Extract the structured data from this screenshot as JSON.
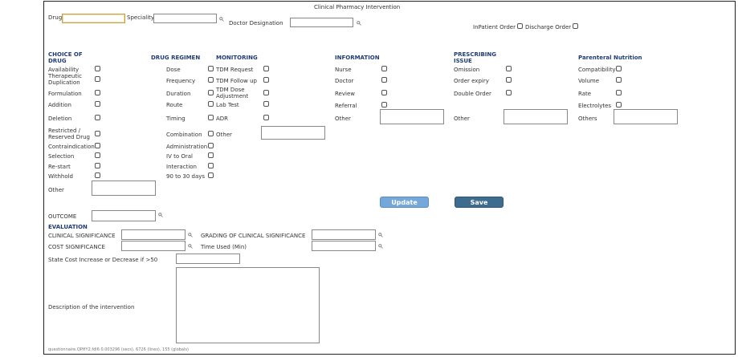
{
  "title": "Clinical Pharmacy Intervention",
  "top": {
    "drug_label": "Drug",
    "speciality_label": "Speciality",
    "doctor_designation_label": "Doctor Designation",
    "inpatient_label": "InPatient Order",
    "discharge_label": "Discharge Order"
  },
  "choice_of_drug": {
    "header": "CHOICE OF DRUG",
    "items": [
      "Availability",
      "Therapeutic Duplication",
      "Formulation",
      "Addition",
      "Deletion",
      "Restricted / Reserved Drug",
      "Contraindication",
      "Selection",
      "Re-start",
      "Withhold"
    ],
    "other_label": "Other"
  },
  "drug_regimen": {
    "header": "DRUG REGIMEN",
    "items": [
      "Dose",
      "Frequency",
      "Duration",
      "Route",
      "Timing",
      "Combination",
      "Administration",
      "IV to Oral",
      "Interaction",
      "90 to 30 days"
    ]
  },
  "monitoring": {
    "header": "MONITORING",
    "items": [
      "TDM Request",
      "TDM Follow up",
      "TDM Dose Adjustment",
      "Lab Test",
      "ADR"
    ],
    "other_label": "Other"
  },
  "information": {
    "header": "INFORMATION",
    "items": [
      "Nurse",
      "Doctor",
      "Review",
      "Referral"
    ],
    "other_label": "Other"
  },
  "prescribing_issue": {
    "header": "PRESCRIBING ISSUE",
    "items": [
      "Omission",
      "Order expiry",
      "Double Order"
    ],
    "other_label": "Other"
  },
  "parenteral_nutrition": {
    "header": "Parenteral Nutrition",
    "items": [
      "Compatibility",
      "Volume",
      "Rate",
      "Electrolytes"
    ],
    "other_label": "Others"
  },
  "buttons": {
    "update": "Update",
    "save": "Save"
  },
  "outcome_label": "OUTCOME",
  "evaluation": {
    "header": "EVALUATION",
    "clinical_significance": "CLINICAL SIGNIFICANCE",
    "grading": "GRADING OF CLINICAL SIGNIFICANCE",
    "cost_significance": "COST SIGNIFICANCE",
    "time_used": "Time Used (Min)",
    "state_cost": "State Cost Increase or Decrease if >50",
    "description": "Description of the intervention"
  },
  "footer": "questionnaire.QPHY2.fdl6  0.003296 (secs),  6726 (lines),  155 (globals)"
}
